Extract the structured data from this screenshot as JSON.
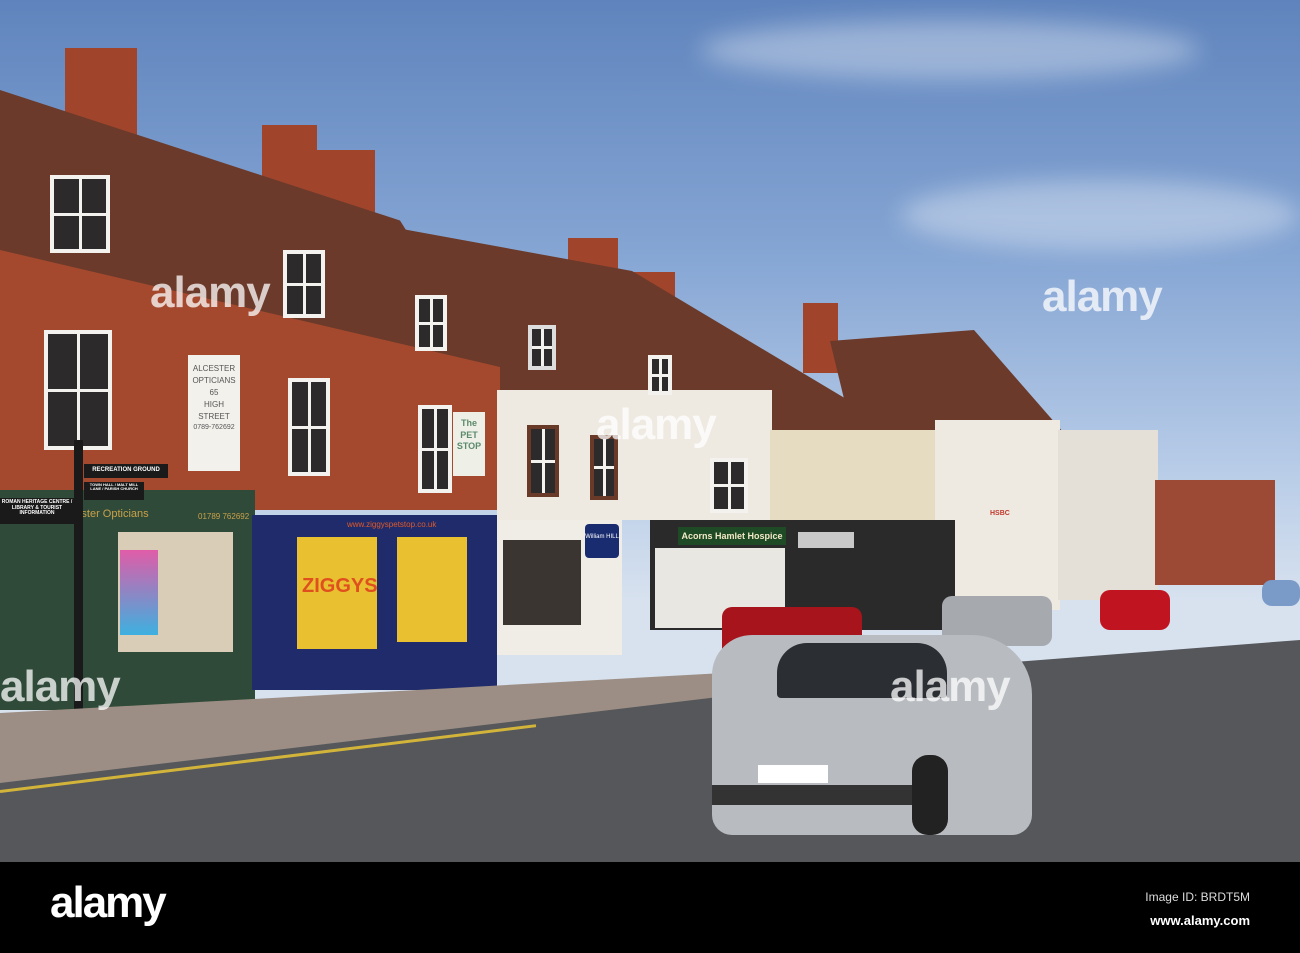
{
  "signs": {
    "opticians_wall": [
      "ALCESTER OPTICIANS",
      "65",
      "HIGH",
      "STREET",
      "0789-762692"
    ],
    "pet_stop_wall": [
      "The",
      "PET",
      "STOP"
    ],
    "opticians_fascia": "Alcester Opticians",
    "opticians_phone": "01789 762692",
    "pet_shop_url": "www.ziggyspetstop.co.uk",
    "pet_shop_window": "ZIGGYS",
    "bookmaker": "William HILL",
    "hospice": "Acorns Hamlet Hospice",
    "bank": "HSBC",
    "fingerpost": [
      "RECREATION GROUND",
      "TOWN HALL / MALT MILL LANE / PARISH CHURCH",
      "ROMAN HERITAGE CENTRE / LIBRARY & TOURIST INFORMATION"
    ]
  },
  "watermark": {
    "text": "alamy"
  },
  "footer": {
    "logo": "alamy",
    "image_id": "Image ID: BRDT5M",
    "url": "www.alamy.com"
  }
}
